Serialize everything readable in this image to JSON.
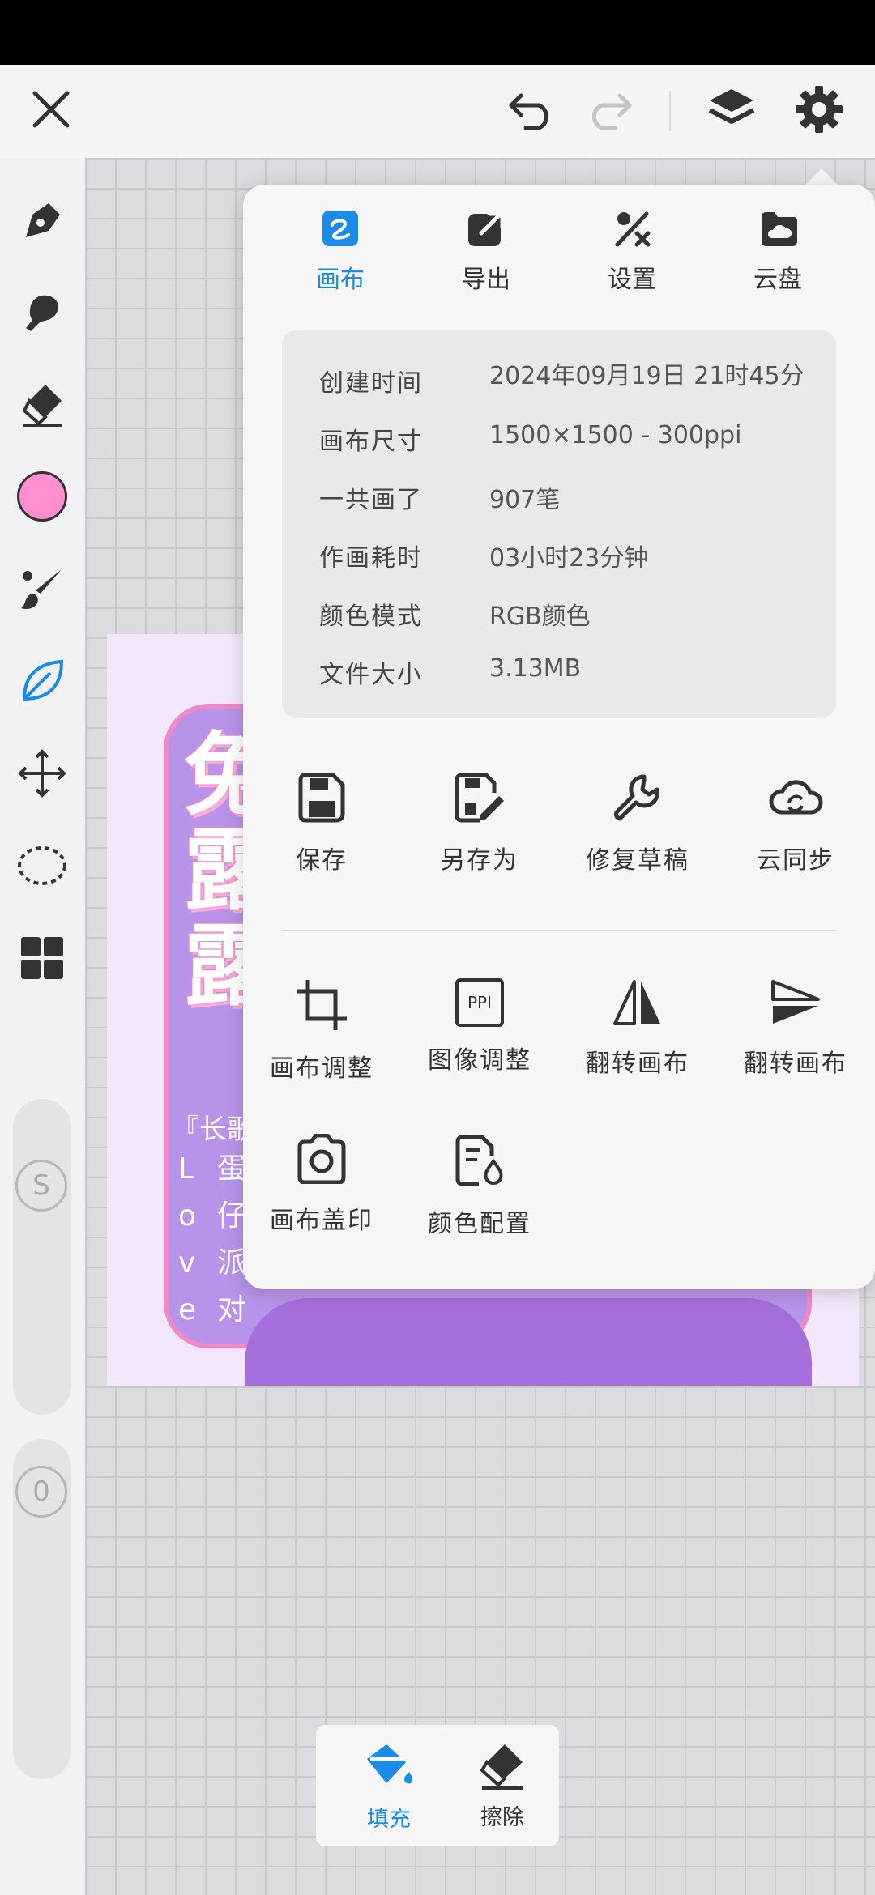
{
  "popup": {
    "tabs": [
      {
        "label": "画布",
        "icon": "canvas-icon",
        "active": true
      },
      {
        "label": "导出",
        "icon": "export-icon",
        "active": false
      },
      {
        "label": "设置",
        "icon": "settings-icon",
        "active": false
      },
      {
        "label": "云盘",
        "icon": "cloud-drive-icon",
        "active": false
      }
    ],
    "info": [
      {
        "key": "创建时间",
        "value": "2024年09月19日 21时45分"
      },
      {
        "key": "画布尺寸",
        "value": "1500×1500 - 300ppi"
      },
      {
        "key": "一共画了",
        "value": "907笔"
      },
      {
        "key": "作画耗时",
        "value": "03小时23分钟"
      },
      {
        "key": "颜色模式",
        "value": "RGB颜色"
      },
      {
        "key": "文件大小",
        "value": "3.13MB"
      }
    ],
    "file_actions": [
      {
        "label": "保存",
        "icon": "save-icon"
      },
      {
        "label": "另存为",
        "icon": "save-as-icon"
      },
      {
        "label": "修复草稿",
        "icon": "repair-icon"
      },
      {
        "label": "云同步",
        "icon": "cloud-sync-icon"
      }
    ],
    "canvas_actions": [
      {
        "label": "画布调整",
        "icon": "crop-icon"
      },
      {
        "label": "图像调整",
        "icon": "ppi-icon",
        "icon_text": "PPI"
      },
      {
        "label": "翻转画布",
        "icon": "flip-horizontal-icon"
      },
      {
        "label": "翻转画布",
        "icon": "flip-vertical-icon"
      },
      {
        "label": "画布盖印",
        "icon": "camera-icon"
      },
      {
        "label": "颜色配置",
        "icon": "color-profile-icon"
      }
    ]
  },
  "sidebar": {
    "current_color": "#ff8fd0",
    "size_slider_label": "S",
    "opacity_slider_label": "0"
  },
  "bottom_tools": [
    {
      "label": "填充",
      "icon": "fill-bucket-icon",
      "active": true
    },
    {
      "label": "擦除",
      "icon": "eraser-icon",
      "active": false
    }
  ],
  "artwork": {
    "hero_text": "兔露露",
    "sub_text": "『长歌",
    "side_letters": "Love",
    "side_chars": "蛋仔派对"
  },
  "colors": {
    "accent": "#1a8be6",
    "icon": "#333333"
  }
}
